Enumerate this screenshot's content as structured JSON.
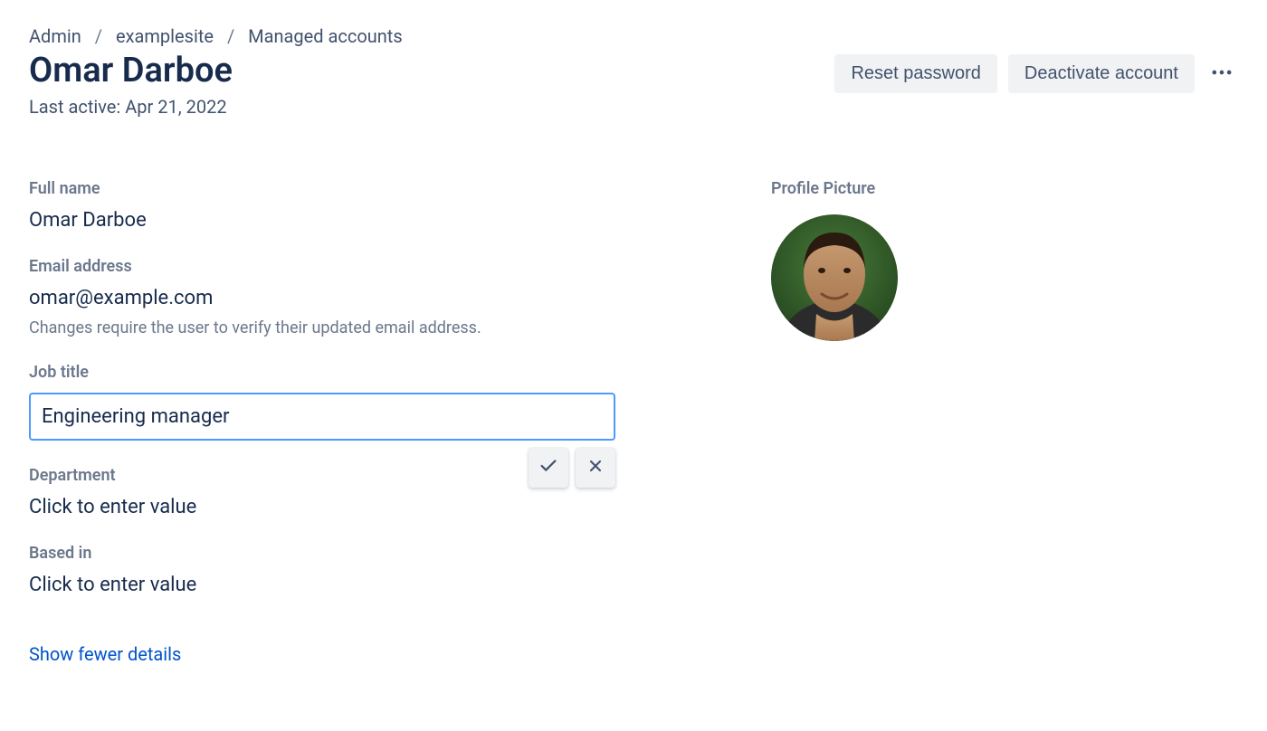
{
  "breadcrumb": {
    "items": [
      "Admin",
      "examplesite",
      "Managed accounts"
    ]
  },
  "header": {
    "title": "Omar Darboe",
    "last_active": "Last active: Apr 21, 2022"
  },
  "actions": {
    "reset_password": "Reset password",
    "deactivate": "Deactivate account"
  },
  "fields": {
    "full_name": {
      "label": "Full name",
      "value": "Omar Darboe"
    },
    "email": {
      "label": "Email address",
      "value": "omar@example.com",
      "helper": "Changes require the user to verify their updated email address."
    },
    "job_title": {
      "label": "Job title",
      "value": "Engineering manager"
    },
    "department": {
      "label": "Department",
      "placeholder": "Click to enter value"
    },
    "based_in": {
      "label": "Based in",
      "placeholder": "Click to enter value"
    }
  },
  "toggle": {
    "label": "Show fewer details"
  },
  "profile_picture": {
    "label": "Profile Picture"
  }
}
